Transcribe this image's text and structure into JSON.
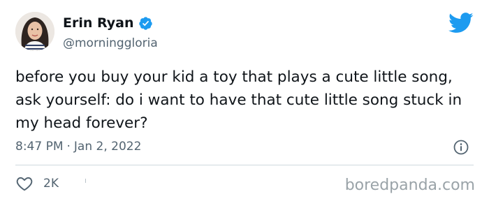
{
  "author": {
    "display_name": "Erin Ryan",
    "handle": "@morninggloria",
    "verified": true
  },
  "tweet": {
    "text": "before you buy your kid a toy that plays a cute little song, ask yourself: do i want to have that cute little song stuck in my head forever?",
    "time": "8:47 PM",
    "separator": "·",
    "date": "Jan 2, 2022"
  },
  "engagement": {
    "likes": "2K"
  },
  "watermark": "boredpanda.com",
  "icons": {
    "bird": "twitter-bird-icon",
    "verified": "verified-badge-icon",
    "info": "info-icon",
    "like": "heart-icon"
  },
  "colors": {
    "brand_blue": "#1d9bf0",
    "text_primary": "#0f1419",
    "text_secondary": "#536471",
    "divider": "#cfd9de"
  }
}
